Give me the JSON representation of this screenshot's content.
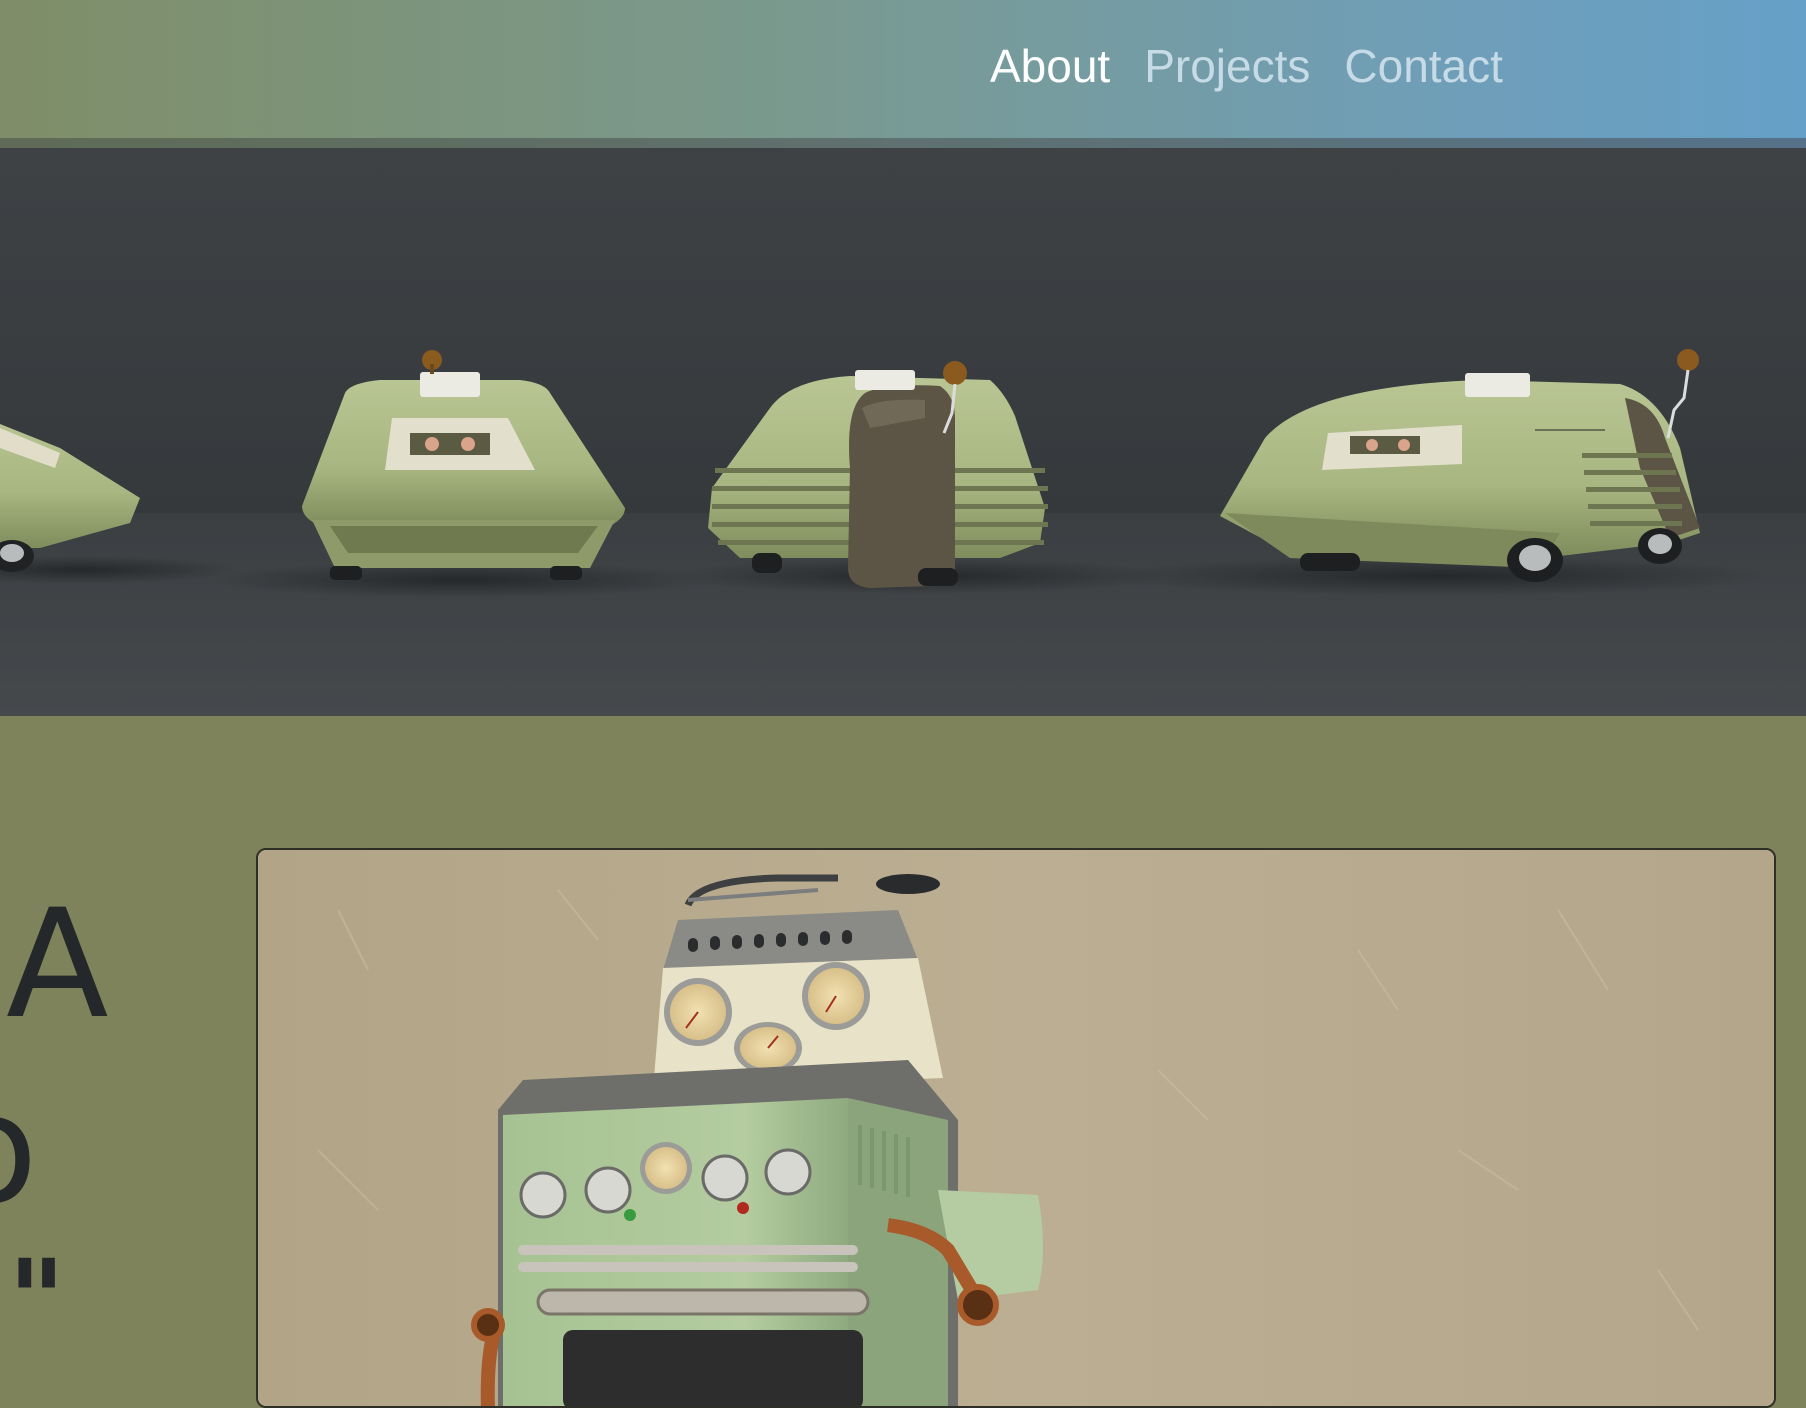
{
  "navbar": {
    "links": [
      {
        "label": "About",
        "active": true
      },
      {
        "label": "Projects",
        "active": false
      },
      {
        "label": "Contact",
        "active": false
      }
    ],
    "gradient_colors": [
      "#7f8e68",
      "#66a0c8"
    ]
  },
  "hero": {
    "image": "retro-green-vehicles-render",
    "background_color": "#3d4043"
  },
  "content": {
    "background_color": "#7e835b",
    "headline_fragments": [
      "A",
      "o",
      "\"",
      "."
    ],
    "photo": {
      "image": "retro-stove-robot-render"
    }
  }
}
